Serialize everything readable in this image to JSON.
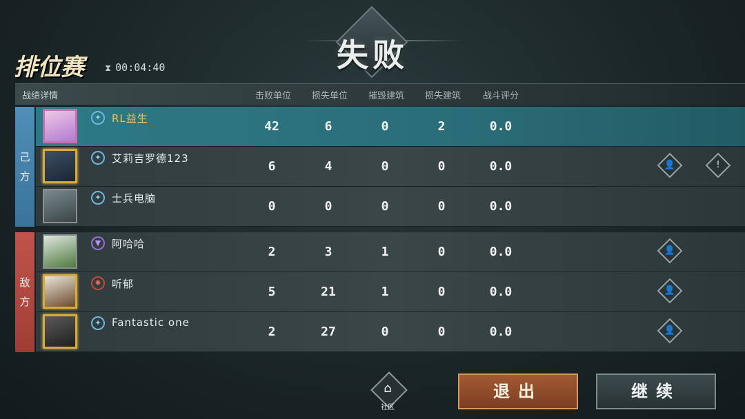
{
  "result_title": "失败",
  "mode_title": "排位赛",
  "timer": {
    "icon": "hourglass-icon",
    "value": "00:04:40"
  },
  "table": {
    "section_title": "战绩详情",
    "columns": [
      "击败单位",
      "损失单位",
      "摧毁建筑",
      "损失建筑",
      "战斗评分"
    ]
  },
  "teams": {
    "own_label": [
      "己",
      "方"
    ],
    "enemy_label": [
      "敌",
      "方"
    ]
  },
  "own_players": [
    {
      "name": "RL益生",
      "stats": [
        "42",
        "6",
        "0",
        "2",
        "0.0"
      ],
      "highlight": true
    },
    {
      "name": "艾莉吉罗德123",
      "stats": [
        "6",
        "4",
        "0",
        "0",
        "0.0"
      ]
    },
    {
      "name": "士兵电脑",
      "stats": [
        "0",
        "0",
        "0",
        "0",
        "0.0"
      ]
    }
  ],
  "enemy_players": [
    {
      "name": "阿哈哈",
      "stats": [
        "2",
        "3",
        "1",
        "0",
        "0.0"
      ]
    },
    {
      "name": "听郁",
      "stats": [
        "5",
        "21",
        "1",
        "0",
        "0.0"
      ]
    },
    {
      "name": "Fantastic one",
      "stats": [
        "2",
        "27",
        "0",
        "0",
        "0.0"
      ]
    }
  ],
  "footer": {
    "community_label": "社区",
    "exit_label": "退出",
    "continue_label": "继续"
  },
  "colors": {
    "own_team": "#4f8fb9",
    "enemy_team": "#c0544a",
    "highlight_row": "#2d7a86",
    "exit_button": "#a35a32"
  }
}
